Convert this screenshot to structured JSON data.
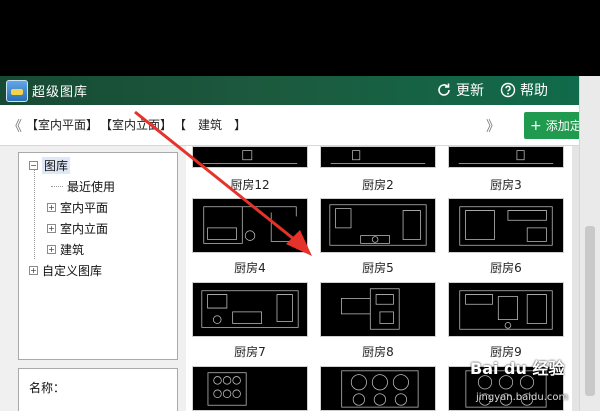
{
  "window": {
    "title": "超级图库",
    "refresh_label": "更新",
    "help_label": "帮助"
  },
  "toolbar": {
    "nav_prev": "《",
    "nav_next": "》",
    "breadcrumbs": [
      "【室内平面】",
      "【室内立面】",
      "【",
      "建筑",
      "】"
    ],
    "add_custom_label": "添加定制"
  },
  "tree": {
    "root": "图库",
    "items": [
      "最近使用",
      "室内平面",
      "室内立面",
      "建筑"
    ],
    "custom": "自定义图库"
  },
  "name_panel": {
    "label": "名称："
  },
  "grid": {
    "items": [
      {
        "label": "厨房12"
      },
      {
        "label": "厨房2"
      },
      {
        "label": "厨房3"
      },
      {
        "label": "厨房4"
      },
      {
        "label": "厨房5"
      },
      {
        "label": "厨房6"
      },
      {
        "label": "厨房7"
      },
      {
        "label": "厨房8"
      },
      {
        "label": "厨房9"
      },
      {
        "label": ""
      },
      {
        "label": ""
      },
      {
        "label": ""
      }
    ]
  },
  "watermark": {
    "logo": "Bai du 经验",
    "url": "jingyan.baidu.com"
  },
  "colors": {
    "titlebar": "#1c5a3e",
    "accent": "#1f9a4f",
    "annotation_arrow": "#e5322b",
    "cad_lines": "#bdbdbd"
  }
}
